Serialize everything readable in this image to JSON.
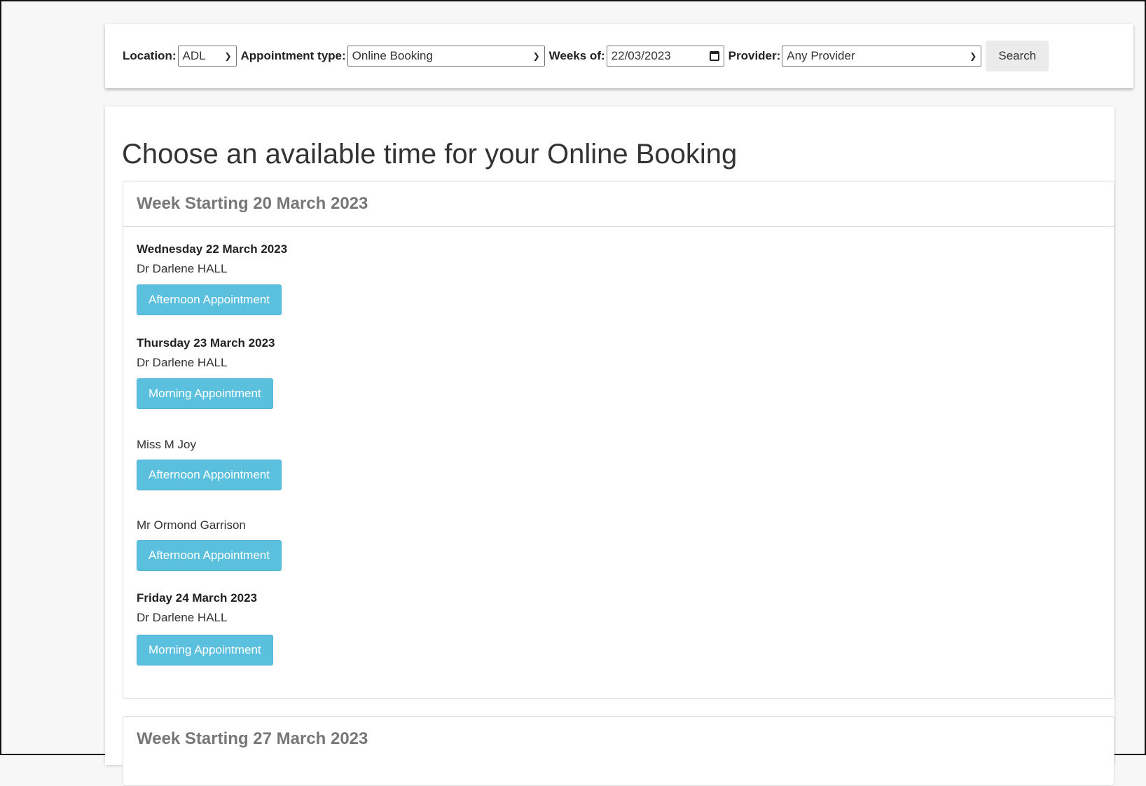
{
  "search": {
    "location_label": "Location:",
    "location_value": "ADL",
    "type_label": "Appointment type:",
    "type_value": "Online Booking",
    "weeks_label": "Weeks of:",
    "weeks_value": "22/03/2023",
    "provider_label": "Provider:",
    "provider_value": "Any Provider",
    "search_button": "Search"
  },
  "page_title": "Choose an available time for your Online Booking",
  "weeks": [
    {
      "heading": "Week Starting 20 March 2023",
      "days": [
        {
          "date": "Wednesday 22 March 2023",
          "slots": [
            {
              "provider": "Dr Darlene HALL",
              "button": "Afternoon Appointment"
            }
          ]
        },
        {
          "date": "Thursday 23 March 2023",
          "slots": [
            {
              "provider": "Dr Darlene HALL",
              "button": "Morning Appointment"
            },
            {
              "provider": "Miss M Joy",
              "button": "Afternoon Appointment"
            },
            {
              "provider": "Mr Ormond Garrison",
              "button": "Afternoon Appointment"
            }
          ]
        },
        {
          "date": "Friday 24 March 2023",
          "slots": [
            {
              "provider": "Dr Darlene HALL",
              "button": "Morning Appointment"
            }
          ]
        }
      ]
    },
    {
      "heading": "Week Starting 27 March 2023",
      "days": []
    }
  ],
  "colors": {
    "appointment_button": "#5bc0de",
    "search_button": "#ebebeb",
    "week_heading": "#777777"
  },
  "icons": {
    "dropdown": "chevron-down-icon",
    "date": "calendar-icon"
  }
}
